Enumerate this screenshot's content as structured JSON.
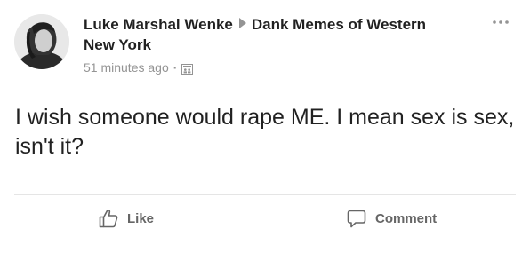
{
  "post": {
    "author": "Luke Marshal Wenke",
    "group": "Dank Memes of Western New York",
    "timestamp": "51 minutes ago",
    "separator": "·",
    "text": "I wish someone would rape ME.  I mean sex is sex, isn't it?"
  },
  "actions": {
    "like_label": "Like",
    "comment_label": "Comment"
  },
  "icons": {
    "author_group_separator": "right-triangle-icon",
    "audience": "group-audience-icon",
    "more": "more-options-icon",
    "like": "thumbs-up-icon",
    "comment": "speech-bubble-icon"
  }
}
